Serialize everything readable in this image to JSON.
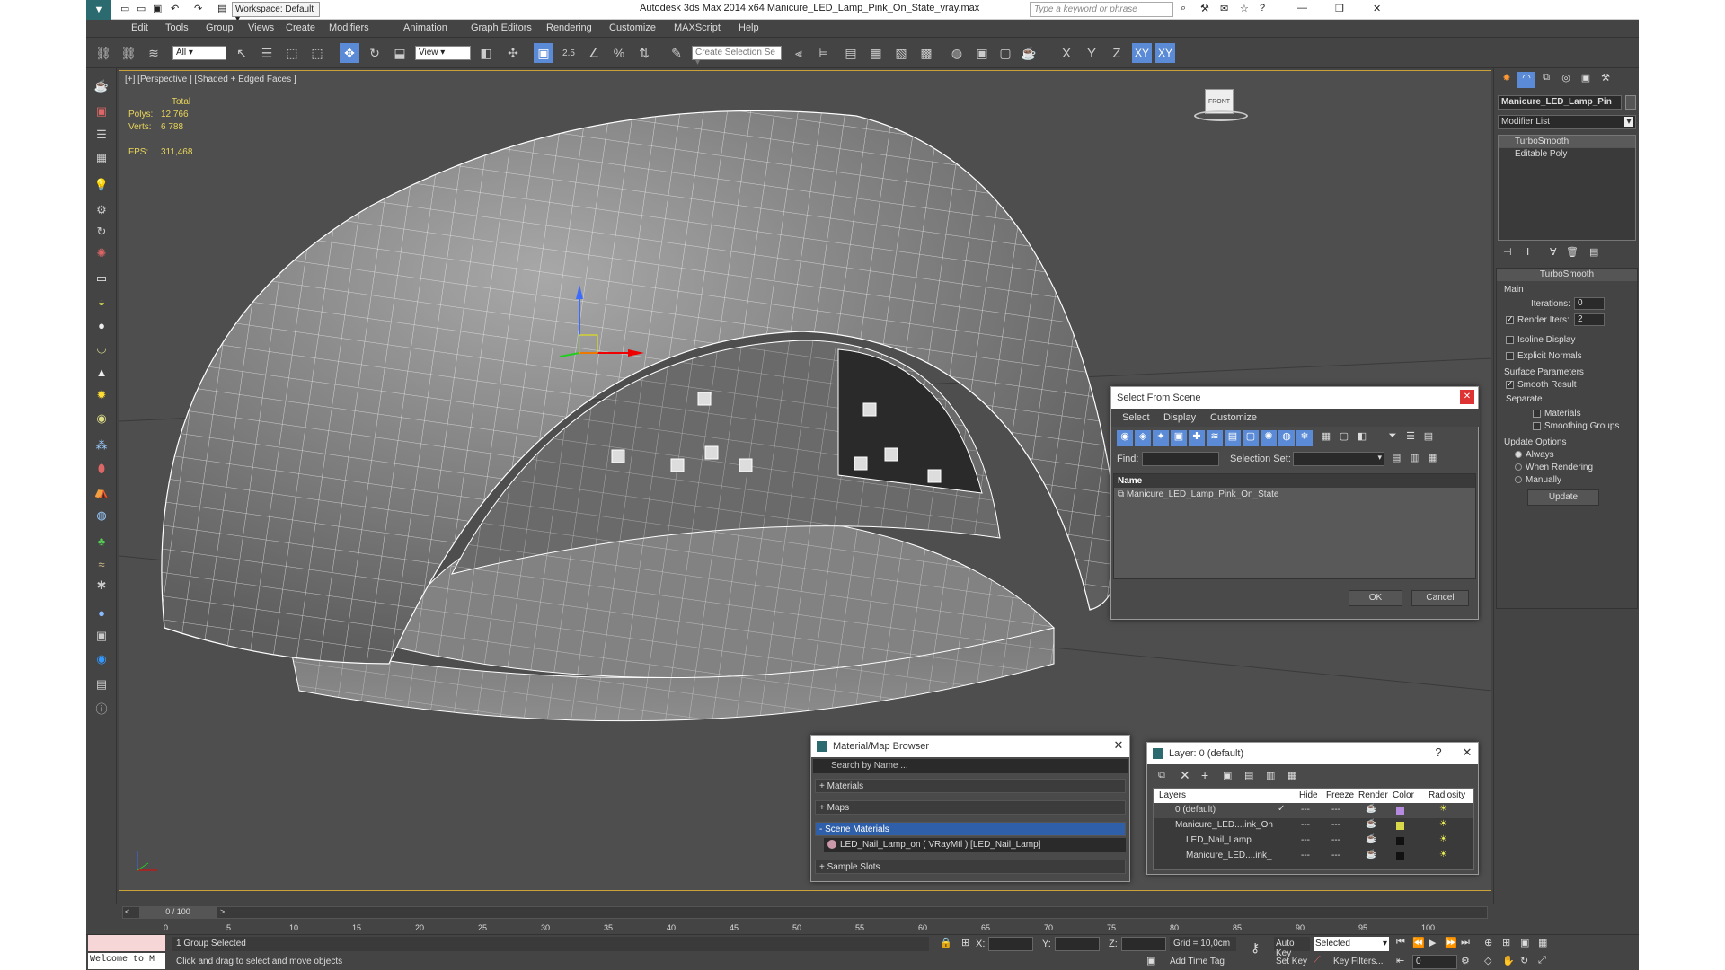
{
  "window": {
    "title": "Autodesk 3ds Max  2014 x64     Manicure_LED_Lamp_Pink_On_State_vray.max",
    "workspace": "Workspace: Default",
    "search_placeholder": "Type a keyword or phrase",
    "min_icon": "minimize-icon",
    "max_icon": "maximize-icon",
    "close_icon": "close-icon"
  },
  "menu": [
    "Edit",
    "Tools",
    "Group",
    "Views",
    "Create",
    "Modifiers",
    "Animation",
    "Graph Editors",
    "Rendering",
    "Customize",
    "MAXScript",
    "Help"
  ],
  "toolbar": {
    "filter": "All",
    "refcoord": "View",
    "create_selection_set": "Create Selection Se",
    "snap_label": "2.5",
    "axis_x": "X",
    "axis_y": "Y",
    "axis_z": "Z",
    "axis_xy": "XY",
    "axis_xy2": "XY"
  },
  "viewport": {
    "label": "[+] [Perspective ] [Shaded + Edged Faces ]",
    "stats_total": "Total",
    "polys_label": "Polys:",
    "polys_value": "12 766",
    "verts_label": "Verts:",
    "verts_value": "6 788",
    "fps_label": "FPS:",
    "fps_value": "311,468",
    "viewcube_label": "FRONT"
  },
  "command_panel": {
    "object_name": "Manicure_LED_Lamp_Pin",
    "modifier_list": "Modifier List",
    "stack": [
      "TurboSmooth",
      "Editable Poly"
    ],
    "rollout_title": "TurboSmooth",
    "main_group": "Main",
    "iterations_label": "Iterations:",
    "iterations_value": "0",
    "render_iters_label": "Render Iters:",
    "render_iters_value": "2",
    "isoline": "Isoline Display",
    "explicit_normals": "Explicit Normals",
    "surface_group": "Surface Parameters",
    "smooth_result": "Smooth Result",
    "separate_label": "Separate",
    "materials": "Materials",
    "smoothing_groups": "Smoothing Groups",
    "update_group": "Update Options",
    "always": "Always",
    "when_rendering": "When Rendering",
    "manually": "Manually",
    "update_btn": "Update"
  },
  "select_dialog": {
    "title": "Select From Scene",
    "menu": [
      "Select",
      "Display",
      "Customize"
    ],
    "find_label": "Find:",
    "selection_set_label": "Selection Set:",
    "column": "Name",
    "items": [
      "Manicure_LED_Lamp_Pink_On_State"
    ],
    "ok": "OK",
    "cancel": "Cancel"
  },
  "material_browser": {
    "title": "Material/Map Browser",
    "search": "Search by Name ...",
    "groups": [
      "+ Materials",
      "+ Maps",
      "- Scene Materials"
    ],
    "scene_item": "LED_Nail_Lamp_on  ( VRayMtl )  [LED_Nail_Lamp]",
    "sample_slots": "+ Sample Slots"
  },
  "layer_dialog": {
    "title": "Layer: 0 (default)",
    "help": "?",
    "columns": [
      "Layers",
      "Hide",
      "Freeze",
      "Render",
      "Color",
      "Radiosity"
    ],
    "rows": [
      {
        "name": "0 (default)",
        "color": "#b58adf"
      },
      {
        "name": "Manicure_LED....ink_On",
        "color": "#d8d84a"
      },
      {
        "name": "LED_Nail_Lamp",
        "color": "#111111"
      },
      {
        "name": "Manicure_LED....ink_",
        "color": "#111111"
      }
    ]
  },
  "timeline": {
    "frame": "0 / 100",
    "ticks": [
      "0",
      "5",
      "10",
      "15",
      "20",
      "25",
      "30",
      "35",
      "40",
      "45",
      "50",
      "55",
      "60",
      "65",
      "70",
      "75",
      "80",
      "85",
      "90",
      "95",
      "100"
    ]
  },
  "status": {
    "maxscript": "Welcome to M",
    "selected": "1 Group Selected",
    "prompt": "Click and drag to select and move objects",
    "x_label": "X:",
    "y_label": "Y:",
    "z_label": "Z:",
    "grid": "Grid = 10,0cm",
    "add_time_tag": "Add Time Tag",
    "auto_key": "Auto Key",
    "set_key": "Set Key",
    "key_mode": "Selected",
    "key_filters": "Key Filters...",
    "frame_value": "0"
  }
}
